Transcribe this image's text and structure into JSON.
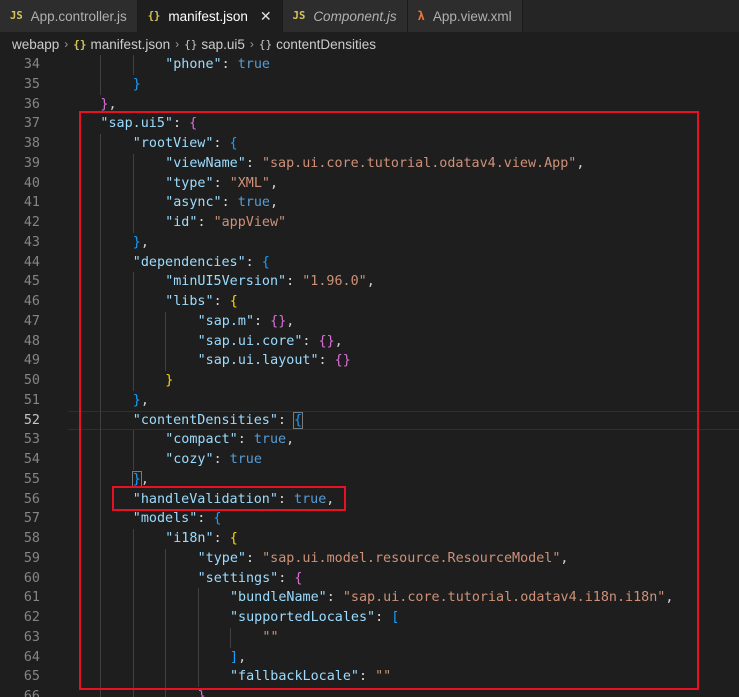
{
  "tabs": [
    {
      "icon": "JS",
      "label": "App.controller.js",
      "active": false,
      "italic": false,
      "type": "js"
    },
    {
      "icon": "{}",
      "label": "manifest.json",
      "active": true,
      "italic": false,
      "type": "json"
    },
    {
      "icon": "JS",
      "label": "Component.js",
      "active": false,
      "italic": true,
      "type": "js"
    },
    {
      "icon": "λ",
      "label": "App.view.xml",
      "active": false,
      "italic": false,
      "type": "xml"
    }
  ],
  "tab_close_glyph": "✕",
  "breadcrumb": {
    "folder": "webapp",
    "file_icon": "{}",
    "file": "manifest.json",
    "sym1_icon": "{}",
    "sym1": "sap.ui5",
    "sym2_icon": "{}",
    "sym2": "contentDensities",
    "sep": "›"
  },
  "current_line": 52,
  "code_lines": [
    {
      "n": 34,
      "ind": 3,
      "toks": [
        {
          "t": "\"phone\"",
          "c": "t-key"
        },
        {
          "t": ": ",
          "c": "t-punc"
        },
        {
          "t": "true",
          "c": "t-bool"
        }
      ]
    },
    {
      "n": 35,
      "ind": 2,
      "toks": [
        {
          "t": "}",
          "c": "b3"
        }
      ]
    },
    {
      "n": 36,
      "ind": 1,
      "toks": [
        {
          "t": "}",
          "c": "b2"
        },
        {
          "t": ",",
          "c": "t-punc"
        }
      ]
    },
    {
      "n": 37,
      "ind": 1,
      "toks": [
        {
          "t": "\"sap.ui5\"",
          "c": "t-key"
        },
        {
          "t": ": ",
          "c": "t-punc"
        },
        {
          "t": "{",
          "c": "b2"
        }
      ]
    },
    {
      "n": 38,
      "ind": 2,
      "toks": [
        {
          "t": "\"rootView\"",
          "c": "t-key"
        },
        {
          "t": ": ",
          "c": "t-punc"
        },
        {
          "t": "{",
          "c": "b3"
        }
      ]
    },
    {
      "n": 39,
      "ind": 3,
      "toks": [
        {
          "t": "\"viewName\"",
          "c": "t-key"
        },
        {
          "t": ": ",
          "c": "t-punc"
        },
        {
          "t": "\"sap.ui.core.tutorial.odatav4.view.App\"",
          "c": "t-str"
        },
        {
          "t": ",",
          "c": "t-punc"
        }
      ]
    },
    {
      "n": 40,
      "ind": 3,
      "toks": [
        {
          "t": "\"type\"",
          "c": "t-key"
        },
        {
          "t": ": ",
          "c": "t-punc"
        },
        {
          "t": "\"XML\"",
          "c": "t-str"
        },
        {
          "t": ",",
          "c": "t-punc"
        }
      ]
    },
    {
      "n": 41,
      "ind": 3,
      "toks": [
        {
          "t": "\"async\"",
          "c": "t-key"
        },
        {
          "t": ": ",
          "c": "t-punc"
        },
        {
          "t": "true",
          "c": "t-bool"
        },
        {
          "t": ",",
          "c": "t-punc"
        }
      ]
    },
    {
      "n": 42,
      "ind": 3,
      "toks": [
        {
          "t": "\"id\"",
          "c": "t-key"
        },
        {
          "t": ": ",
          "c": "t-punc"
        },
        {
          "t": "\"appView\"",
          "c": "t-str"
        }
      ]
    },
    {
      "n": 43,
      "ind": 2,
      "toks": [
        {
          "t": "}",
          "c": "b3"
        },
        {
          "t": ",",
          "c": "t-punc"
        }
      ]
    },
    {
      "n": 44,
      "ind": 2,
      "toks": [
        {
          "t": "\"dependencies\"",
          "c": "t-key"
        },
        {
          "t": ": ",
          "c": "t-punc"
        },
        {
          "t": "{",
          "c": "b3"
        }
      ]
    },
    {
      "n": 45,
      "ind": 3,
      "toks": [
        {
          "t": "\"minUI5Version\"",
          "c": "t-key"
        },
        {
          "t": ": ",
          "c": "t-punc"
        },
        {
          "t": "\"1.96.0\"",
          "c": "t-str"
        },
        {
          "t": ",",
          "c": "t-punc"
        }
      ]
    },
    {
      "n": 46,
      "ind": 3,
      "toks": [
        {
          "t": "\"libs\"",
          "c": "t-key"
        },
        {
          "t": ": ",
          "c": "t-punc"
        },
        {
          "t": "{",
          "c": "b1"
        }
      ]
    },
    {
      "n": 47,
      "ind": 4,
      "toks": [
        {
          "t": "\"sap.m\"",
          "c": "t-key"
        },
        {
          "t": ": ",
          "c": "t-punc"
        },
        {
          "t": "{}",
          "c": "b2"
        },
        {
          "t": ",",
          "c": "t-punc"
        }
      ]
    },
    {
      "n": 48,
      "ind": 4,
      "toks": [
        {
          "t": "\"sap.ui.core\"",
          "c": "t-key"
        },
        {
          "t": ": ",
          "c": "t-punc"
        },
        {
          "t": "{}",
          "c": "b2"
        },
        {
          "t": ",",
          "c": "t-punc"
        }
      ]
    },
    {
      "n": 49,
      "ind": 4,
      "toks": [
        {
          "t": "\"sap.ui.layout\"",
          "c": "t-key"
        },
        {
          "t": ": ",
          "c": "t-punc"
        },
        {
          "t": "{}",
          "c": "b2"
        }
      ]
    },
    {
      "n": 50,
      "ind": 3,
      "toks": [
        {
          "t": "}",
          "c": "b1"
        }
      ]
    },
    {
      "n": 51,
      "ind": 2,
      "toks": [
        {
          "t": "}",
          "c": "b3"
        },
        {
          "t": ",",
          "c": "t-punc"
        }
      ]
    },
    {
      "n": 52,
      "ind": 2,
      "toks": [
        {
          "t": "\"contentDensities\"",
          "c": "t-key"
        },
        {
          "t": ": ",
          "c": "t-punc"
        },
        {
          "t": "{",
          "c": "b3 bm"
        }
      ]
    },
    {
      "n": 53,
      "ind": 3,
      "toks": [
        {
          "t": "\"compact\"",
          "c": "t-key"
        },
        {
          "t": ": ",
          "c": "t-punc"
        },
        {
          "t": "true",
          "c": "t-bool"
        },
        {
          "t": ",",
          "c": "t-punc"
        }
      ]
    },
    {
      "n": 54,
      "ind": 3,
      "toks": [
        {
          "t": "\"cozy\"",
          "c": "t-key"
        },
        {
          "t": ": ",
          "c": "t-punc"
        },
        {
          "t": "true",
          "c": "t-bool"
        }
      ]
    },
    {
      "n": 55,
      "ind": 2,
      "toks": [
        {
          "t": "}",
          "c": "b3 bm"
        },
        {
          "t": ",",
          "c": "t-punc"
        }
      ]
    },
    {
      "n": 56,
      "ind": 2,
      "toks": [
        {
          "t": "\"handleValidation\"",
          "c": "t-key"
        },
        {
          "t": ": ",
          "c": "t-punc"
        },
        {
          "t": "true",
          "c": "t-bool"
        },
        {
          "t": ",",
          "c": "t-punc"
        }
      ]
    },
    {
      "n": 57,
      "ind": 2,
      "toks": [
        {
          "t": "\"models\"",
          "c": "t-key"
        },
        {
          "t": ": ",
          "c": "t-punc"
        },
        {
          "t": "{",
          "c": "b3"
        }
      ]
    },
    {
      "n": 58,
      "ind": 3,
      "toks": [
        {
          "t": "\"i18n\"",
          "c": "t-key"
        },
        {
          "t": ": ",
          "c": "t-punc"
        },
        {
          "t": "{",
          "c": "b1"
        }
      ]
    },
    {
      "n": 59,
      "ind": 4,
      "toks": [
        {
          "t": "\"type\"",
          "c": "t-key"
        },
        {
          "t": ": ",
          "c": "t-punc"
        },
        {
          "t": "\"sap.ui.model.resource.ResourceModel\"",
          "c": "t-str"
        },
        {
          "t": ",",
          "c": "t-punc"
        }
      ]
    },
    {
      "n": 60,
      "ind": 4,
      "toks": [
        {
          "t": "\"settings\"",
          "c": "t-key"
        },
        {
          "t": ": ",
          "c": "t-punc"
        },
        {
          "t": "{",
          "c": "b2"
        }
      ]
    },
    {
      "n": 61,
      "ind": 5,
      "toks": [
        {
          "t": "\"bundleName\"",
          "c": "t-key"
        },
        {
          "t": ": ",
          "c": "t-punc"
        },
        {
          "t": "\"sap.ui.core.tutorial.odatav4.i18n.i18n\"",
          "c": "t-str"
        },
        {
          "t": ",",
          "c": "t-punc"
        }
      ]
    },
    {
      "n": 62,
      "ind": 5,
      "toks": [
        {
          "t": "\"supportedLocales\"",
          "c": "t-key"
        },
        {
          "t": ": ",
          "c": "t-punc"
        },
        {
          "t": "[",
          "c": "b3"
        }
      ]
    },
    {
      "n": 63,
      "ind": 6,
      "toks": [
        {
          "t": "\"\"",
          "c": "t-str"
        }
      ]
    },
    {
      "n": 64,
      "ind": 5,
      "toks": [
        {
          "t": "]",
          "c": "b3"
        },
        {
          "t": ",",
          "c": "t-punc"
        }
      ]
    },
    {
      "n": 65,
      "ind": 5,
      "toks": [
        {
          "t": "\"fallbackLocale\"",
          "c": "t-key"
        },
        {
          "t": ": ",
          "c": "t-punc"
        },
        {
          "t": "\"\"",
          "c": "t-str"
        }
      ]
    },
    {
      "n": 66,
      "ind": 4,
      "toks": [
        {
          "t": "}",
          "c": "b2"
        }
      ]
    }
  ]
}
